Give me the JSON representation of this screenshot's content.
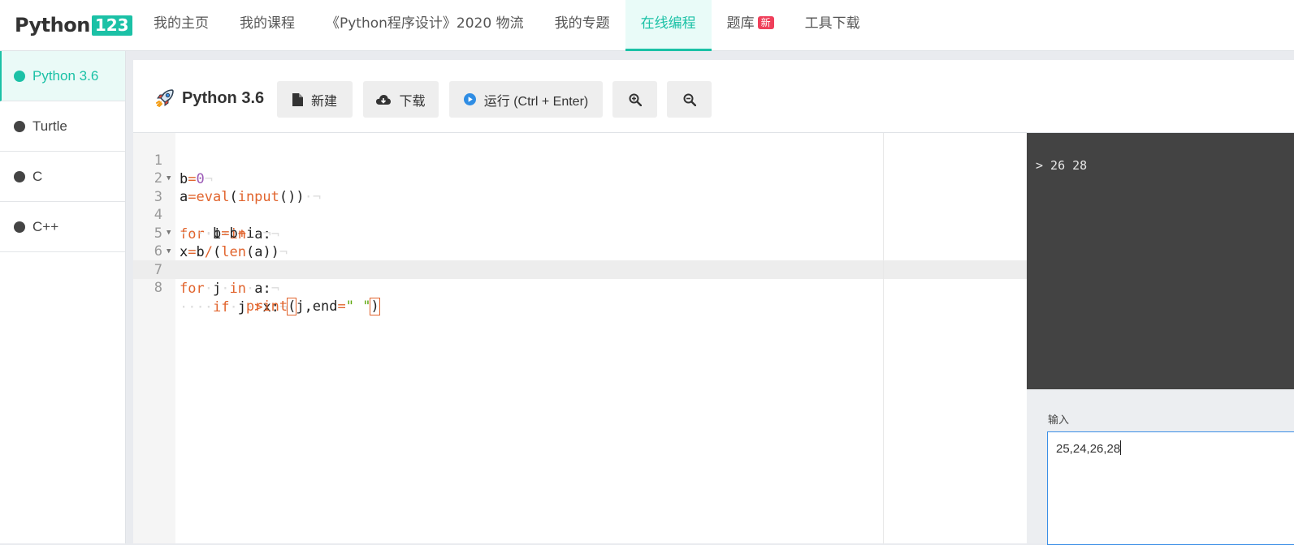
{
  "logo": {
    "text": "Python",
    "badge": "123"
  },
  "nav": {
    "items": [
      {
        "label": "我的主页"
      },
      {
        "label": "我的课程"
      },
      {
        "label": "《Python程序设计》2020 物流"
      },
      {
        "label": "我的专题"
      },
      {
        "label": "在线编程",
        "active": true
      },
      {
        "label": "题库",
        "badge": "新"
      },
      {
        "label": "工具下载"
      }
    ]
  },
  "sidebar": {
    "items": [
      {
        "label": "Python 3.6",
        "active": true
      },
      {
        "label": "Turtle"
      },
      {
        "label": "C"
      },
      {
        "label": "C++"
      }
    ]
  },
  "toolbar": {
    "title": "Python 3.6",
    "new_label": "新建",
    "download_label": "下载",
    "run_label": "运行 (Ctrl + Enter)",
    "icons": [
      "rocket-icon",
      "file-icon",
      "cloud-download-icon",
      "play-icon",
      "zoom-in-icon",
      "zoom-out-icon"
    ]
  },
  "editor": {
    "line_numbers": [
      "1",
      "2",
      "3",
      "4",
      "5",
      "6",
      "7",
      "8"
    ],
    "active_line": "8"
  },
  "output": {
    "text": "> 26 28"
  },
  "input": {
    "label": "输入",
    "value": "25,24,26,28"
  },
  "colors": {
    "accent": "#1bc1a6",
    "badge": "#ef3f5a",
    "keyword": "#e1642d",
    "number": "#9b59b6",
    "string": "#5fa80f",
    "output_bg": "#434343"
  }
}
